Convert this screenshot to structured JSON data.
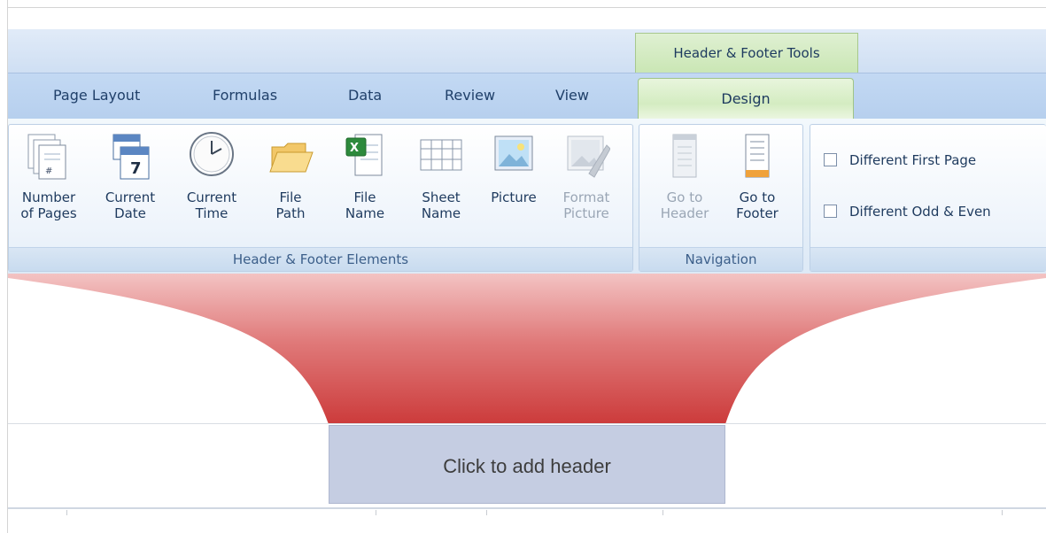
{
  "context_tab": {
    "title": "Header & Footer Tools",
    "tab": "Design"
  },
  "tabs": [
    {
      "label": "Page Layout"
    },
    {
      "label": "Formulas"
    },
    {
      "label": "Data"
    },
    {
      "label": "Review"
    },
    {
      "label": "View"
    }
  ],
  "groups": {
    "elements": {
      "label": "Header & Footer Elements",
      "buttons": [
        {
          "line1": "Number",
          "line2": "of Pages",
          "icon": "number-of-pages-icon",
          "enabled": true
        },
        {
          "line1": "Current",
          "line2": "Date",
          "icon": "calendar-icon",
          "enabled": true
        },
        {
          "line1": "Current",
          "line2": "Time",
          "icon": "clock-icon",
          "enabled": true
        },
        {
          "line1": "File",
          "line2": "Path",
          "icon": "folder-icon",
          "enabled": true
        },
        {
          "line1": "File",
          "line2": "Name",
          "icon": "excel-file-icon",
          "enabled": true
        },
        {
          "line1": "Sheet",
          "line2": "Name",
          "icon": "sheet-grid-icon",
          "enabled": true
        },
        {
          "line1": "Picture",
          "line2": "",
          "icon": "picture-icon",
          "enabled": true
        },
        {
          "line1": "Format",
          "line2": "Picture",
          "icon": "format-picture-icon",
          "enabled": false
        }
      ]
    },
    "navigation": {
      "label": "Navigation",
      "buttons": [
        {
          "line1": "Go to",
          "line2": "Header",
          "icon": "go-to-header-icon",
          "enabled": false
        },
        {
          "line1": "Go to",
          "line2": "Footer",
          "icon": "go-to-footer-icon",
          "enabled": true
        }
      ]
    },
    "options": {
      "checkboxes": [
        {
          "label": "Different First Page",
          "checked": false
        },
        {
          "label": "Different Odd & Even",
          "checked": false
        }
      ]
    }
  },
  "sheet": {
    "header_placeholder": "Click to add header"
  },
  "colors": {
    "accent_red": "#cc3333",
    "ribbon_blue": "#c3d9f3",
    "context_green": "#d4ecc1"
  }
}
